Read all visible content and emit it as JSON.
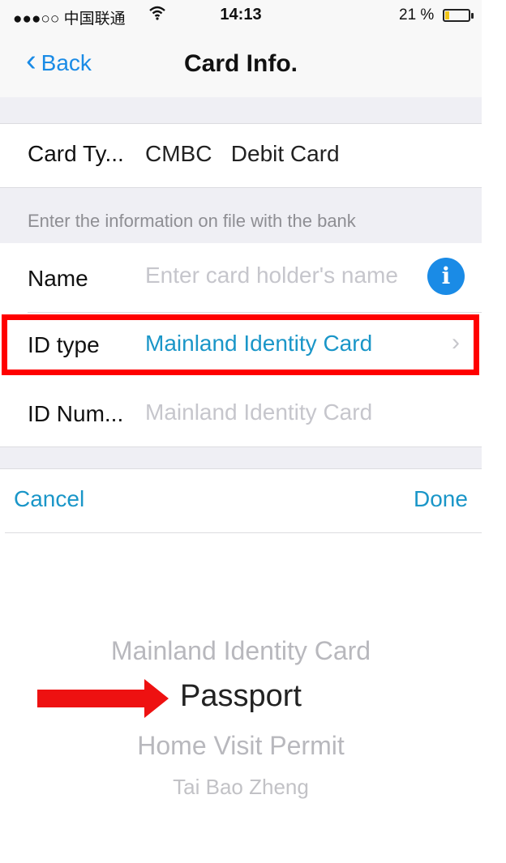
{
  "status_bar": {
    "carrier": "●●●○○ 中国联通",
    "time": "14:13",
    "battery": "21 %",
    "battery_level": 0.21,
    "wifi_icon": "wifi-icon"
  },
  "nav": {
    "back_label": "Back",
    "title": "Card Info."
  },
  "card": {
    "type_label": "Card Ty...",
    "type_value": "CMBC   Debit Card"
  },
  "section_hint": "Enter the information on file with the bank",
  "form": {
    "name_label": "Name",
    "name_placeholder": "Enter card holder's name",
    "id_type_label": "ID type",
    "id_type_value": "Mainland Identity Card",
    "id_number_label": "ID Num...",
    "id_number_placeholder": "Mainland Identity Card"
  },
  "toolbar": {
    "cancel_label": "Cancel",
    "done_label": "Done"
  },
  "picker": {
    "options": [
      "Mainland Identity Card",
      "Passport",
      "Home Visit Permit",
      "Tai Bao Zheng"
    ],
    "selected": "Passport"
  },
  "colors": {
    "accent": "#1a8be6",
    "value_blue": "#1a96c8",
    "highlight_red": "#ff0000"
  }
}
